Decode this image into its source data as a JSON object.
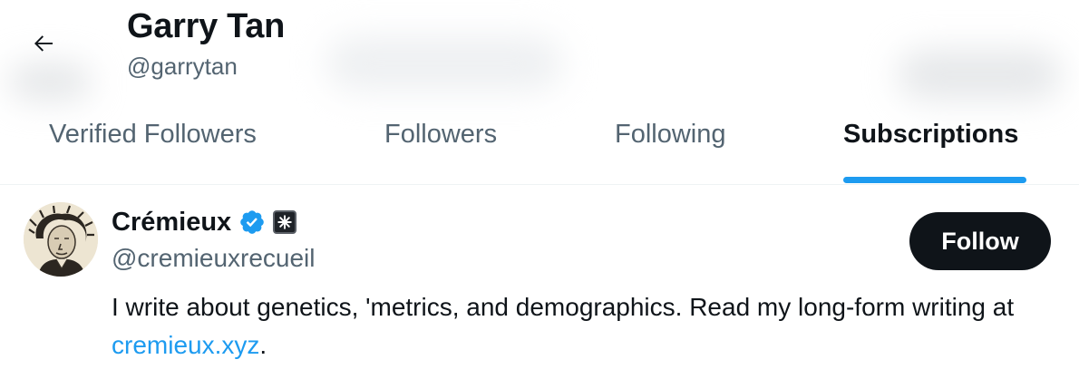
{
  "header": {
    "title": "Garry Tan",
    "handle": "@garrytan",
    "back_icon": "arrow-left-icon"
  },
  "tabs": [
    {
      "label": "Verified Followers",
      "active": false
    },
    {
      "label": "Followers",
      "active": false
    },
    {
      "label": "Following",
      "active": false
    },
    {
      "label": "Subscriptions",
      "active": true
    }
  ],
  "user": {
    "display_name": "Crémieux",
    "verified_icon": "verified-badge-icon",
    "subscription_icon": "subscription-badge-icon",
    "handle": "@cremieuxrecueil",
    "follow_label": "Follow",
    "bio_text": "I write about genetics, 'metrics, and demographics. Read my long-form writing at ",
    "bio_link": "cremieux.xyz",
    "bio_end": "."
  },
  "colors": {
    "accent": "#1d9bf0",
    "text_primary": "#0f1419",
    "text_secondary": "#536471",
    "follow_button_bg": "#0f1419"
  }
}
